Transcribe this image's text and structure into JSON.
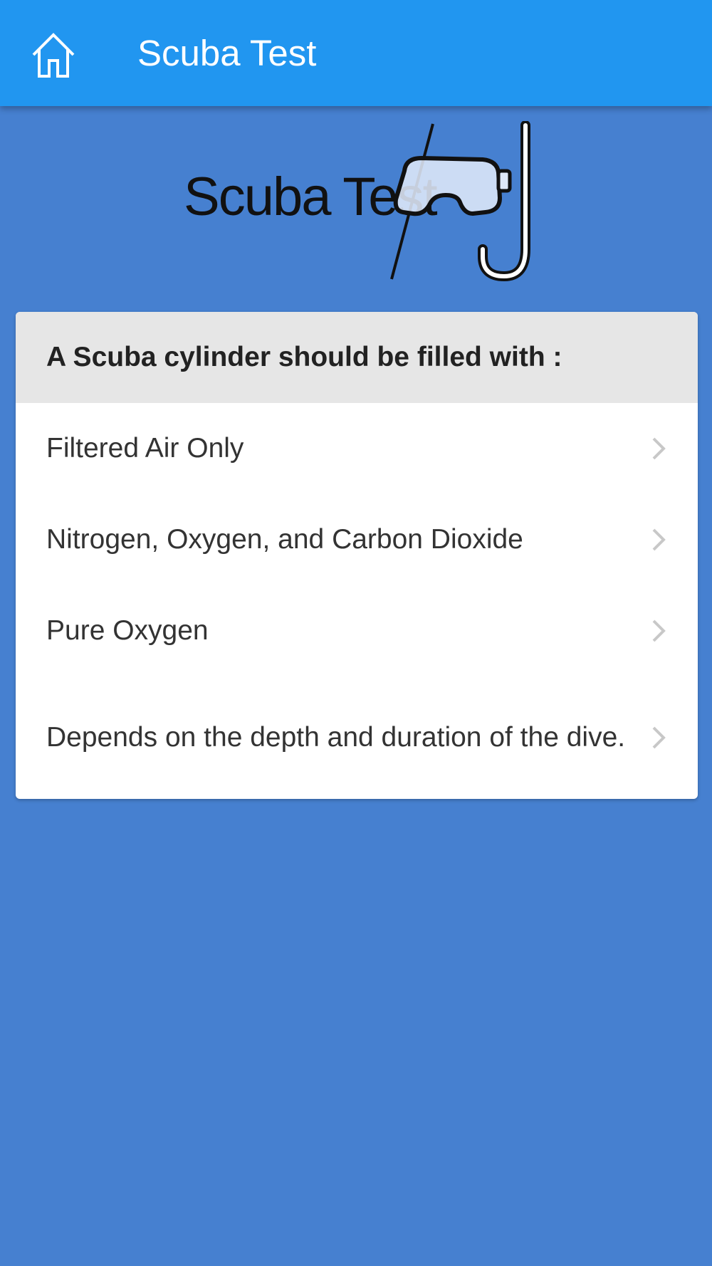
{
  "app_bar": {
    "title": "Scuba Test",
    "home_icon": "home-icon"
  },
  "logo": {
    "text": "Scuba Test",
    "icon": "snorkel-mask-icon"
  },
  "quiz": {
    "question": "A Scuba cylinder should be filled with :",
    "answers": [
      "Filtered Air Only",
      "Nitrogen, Oxygen, and Carbon Dioxide",
      "Pure Oxygen",
      "Depends on the depth and duration of the dive."
    ],
    "answer_icon": "chevron-right-icon"
  },
  "colors": {
    "app_bar": "#2196f0",
    "background": "#4680d0",
    "card_header": "#e6e6e6",
    "card": "#ffffff"
  }
}
